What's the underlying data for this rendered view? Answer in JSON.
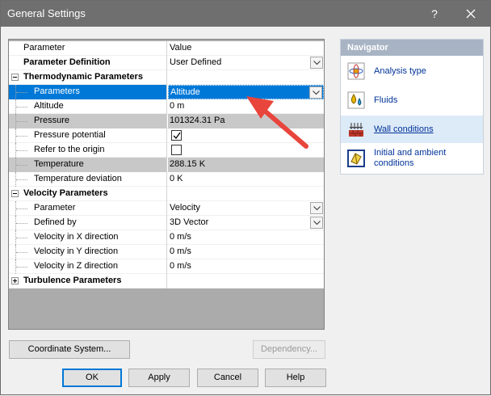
{
  "window": {
    "title": "General Settings",
    "help_glyph": "?"
  },
  "grid": {
    "header": {
      "parameter": "Parameter",
      "value": "Value"
    },
    "rows": [
      {
        "label": "Parameter Definition",
        "value": "User Defined"
      },
      {
        "label": "Thermodynamic Parameters",
        "value": ""
      },
      {
        "label": "Parameters",
        "value": "Altitude"
      },
      {
        "label": "Altitude",
        "value": "0 m"
      },
      {
        "label": "Pressure",
        "value": "101324.31 Pa"
      },
      {
        "label": "Pressure potential",
        "value": ""
      },
      {
        "label": "Refer to the origin",
        "value": ""
      },
      {
        "label": "Temperature",
        "value": "288.15 K"
      },
      {
        "label": "Temperature deviation",
        "value": "0 K"
      },
      {
        "label": "Velocity Parameters",
        "value": ""
      },
      {
        "label": "Parameter",
        "value": "Velocity"
      },
      {
        "label": "Defined by",
        "value": "3D Vector"
      },
      {
        "label": "Velocity in X direction",
        "value": "0 m/s"
      },
      {
        "label": "Velocity in Y direction",
        "value": "0 m/s"
      },
      {
        "label": "Velocity in Z direction",
        "value": "0 m/s"
      },
      {
        "label": "Turbulence Parameters",
        "value": ""
      }
    ],
    "pressure_potential_checked": true,
    "refer_to_origin_checked": false
  },
  "navigator": {
    "title": "Navigator",
    "items": [
      {
        "label": "Analysis type",
        "icon": "analysis-type-icon"
      },
      {
        "label": "Fluids",
        "icon": "fluids-icon"
      },
      {
        "label": "Wall conditions",
        "icon": "wall-conditions-icon"
      },
      {
        "label": "Initial and ambient conditions",
        "icon": "initial-conditions-icon"
      }
    ],
    "active_index": 2
  },
  "buttons": {
    "coordinate_system": "Coordinate System...",
    "dependency": "Dependency...",
    "ok": "OK",
    "apply": "Apply",
    "cancel": "Cancel",
    "help": "Help"
  },
  "colors": {
    "titlebar": "#6f6f6f",
    "selection": "#0078d7",
    "annotation_arrow": "#e8453c",
    "nav_header": "#a8b4c4",
    "nav_link": "#003399"
  }
}
